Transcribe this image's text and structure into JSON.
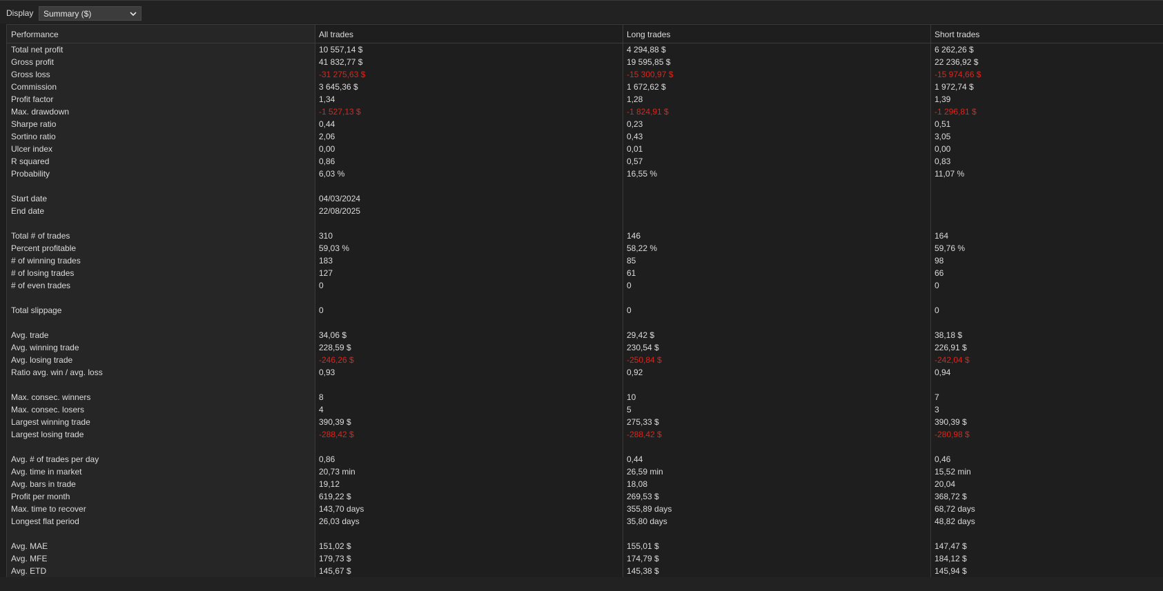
{
  "toolbar": {
    "display_label": "Display",
    "display_value": "Summary ($)"
  },
  "colors": {
    "negative": "#e0241b",
    "text": "#dcdcdc",
    "background": "#1e1e1e"
  },
  "table": {
    "headers": [
      "Performance",
      "All trades",
      "Long trades",
      "Short trades"
    ],
    "rows": [
      {
        "label": "Total net profit",
        "all": "10 557,14 $",
        "long": "4 294,88 $",
        "short": "6 262,26 $",
        "negative": false
      },
      {
        "label": "Gross profit",
        "all": "41 832,77 $",
        "long": "19 595,85 $",
        "short": "22 236,92 $",
        "negative": false
      },
      {
        "label": "Gross loss",
        "all": "-31 275,63 $",
        "long": "-15 300,97 $",
        "short": "-15 974,66 $",
        "negative": true
      },
      {
        "label": "Commission",
        "all": "3 645,36 $",
        "long": "1 672,62 $",
        "short": "1 972,74 $",
        "negative": false
      },
      {
        "label": "Profit factor",
        "all": "1,34",
        "long": "1,28",
        "short": "1,39",
        "negative": false
      },
      {
        "label": "Max. drawdown",
        "all": "-1 527,13 $",
        "long": "-1 824,91 $",
        "short": "-1 296,81 $",
        "negative": true
      },
      {
        "label": "Sharpe ratio",
        "all": "0,44",
        "long": "0,23",
        "short": "0,51",
        "negative": false
      },
      {
        "label": "Sortino ratio",
        "all": "2,06",
        "long": "0,43",
        "short": "3,05",
        "negative": false
      },
      {
        "label": "Ulcer index",
        "all": "0,00",
        "long": "0,01",
        "short": "0,00",
        "negative": false
      },
      {
        "label": "R squared",
        "all": "0,86",
        "long": "0,57",
        "short": "0,83",
        "negative": false
      },
      {
        "label": "Probability",
        "all": "6,03 %",
        "long": "16,55 %",
        "short": "11,07 %",
        "negative": false
      },
      {
        "label": "",
        "all": "",
        "long": "",
        "short": "",
        "negative": false
      },
      {
        "label": "Start date",
        "all": "04/03/2024",
        "long": "",
        "short": "",
        "negative": false
      },
      {
        "label": "End date",
        "all": "22/08/2025",
        "long": "",
        "short": "",
        "negative": false
      },
      {
        "label": "",
        "all": "",
        "long": "",
        "short": "",
        "negative": false
      },
      {
        "label": "Total # of trades",
        "all": "310",
        "long": "146",
        "short": "164",
        "negative": false
      },
      {
        "label": "Percent profitable",
        "all": "59,03 %",
        "long": "58,22 %",
        "short": "59,76 %",
        "negative": false
      },
      {
        "label": "# of winning trades",
        "all": "183",
        "long": "85",
        "short": "98",
        "negative": false
      },
      {
        "label": "# of losing trades",
        "all": "127",
        "long": "61",
        "short": "66",
        "negative": false
      },
      {
        "label": "# of even trades",
        "all": "0",
        "long": "0",
        "short": "0",
        "negative": false
      },
      {
        "label": "",
        "all": "",
        "long": "",
        "short": "",
        "negative": false
      },
      {
        "label": "Total slippage",
        "all": "0",
        "long": "0",
        "short": "0",
        "negative": false
      },
      {
        "label": "",
        "all": "",
        "long": "",
        "short": "",
        "negative": false
      },
      {
        "label": "Avg. trade",
        "all": "34,06 $",
        "long": "29,42 $",
        "short": "38,18 $",
        "negative": false
      },
      {
        "label": "Avg. winning trade",
        "all": "228,59 $",
        "long": "230,54 $",
        "short": "226,91 $",
        "negative": false
      },
      {
        "label": "Avg. losing trade",
        "all": "-246,26 $",
        "long": "-250,84 $",
        "short": "-242,04 $",
        "negative": true
      },
      {
        "label": "Ratio avg. win / avg. loss",
        "all": "0,93",
        "long": "0,92",
        "short": "0,94",
        "negative": false
      },
      {
        "label": "",
        "all": "",
        "long": "",
        "short": "",
        "negative": false
      },
      {
        "label": "Max. consec. winners",
        "all": "8",
        "long": "10",
        "short": "7",
        "negative": false
      },
      {
        "label": "Max. consec. losers",
        "all": "4",
        "long": "5",
        "short": "3",
        "negative": false
      },
      {
        "label": "Largest winning trade",
        "all": "390,39 $",
        "long": "275,33 $",
        "short": "390,39 $",
        "negative": false
      },
      {
        "label": "Largest losing trade",
        "all": "-288,42 $",
        "long": "-288,42 $",
        "short": "-280,98 $",
        "negative": true
      },
      {
        "label": "",
        "all": "",
        "long": "",
        "short": "",
        "negative": false
      },
      {
        "label": "Avg. # of trades per day",
        "all": "0,86",
        "long": "0,44",
        "short": "0,46",
        "negative": false
      },
      {
        "label": "Avg. time in market",
        "all": "20,73 min",
        "long": "26,59 min",
        "short": "15,52 min",
        "negative": false
      },
      {
        "label": "Avg. bars in trade",
        "all": "19,12",
        "long": "18,08",
        "short": "20,04",
        "negative": false
      },
      {
        "label": "Profit per month",
        "all": "619,22 $",
        "long": "269,53 $",
        "short": "368,72 $",
        "negative": false
      },
      {
        "label": "Max. time to recover",
        "all": "143,70 days",
        "long": "355,89 days",
        "short": "68,72 days",
        "negative": false
      },
      {
        "label": "Longest flat period",
        "all": "26,03 days",
        "long": "35,80 days",
        "short": "48,82 days",
        "negative": false
      },
      {
        "label": "",
        "all": "",
        "long": "",
        "short": "",
        "negative": false
      },
      {
        "label": "Avg. MAE",
        "all": "151,02 $",
        "long": "155,01 $",
        "short": "147,47 $",
        "negative": false
      },
      {
        "label": "Avg. MFE",
        "all": "179,73 $",
        "long": "174,79 $",
        "short": "184,12 $",
        "negative": false
      },
      {
        "label": "Avg. ETD",
        "all": "145,67 $",
        "long": "145,38 $",
        "short": "145,94 $",
        "negative": false
      }
    ]
  }
}
